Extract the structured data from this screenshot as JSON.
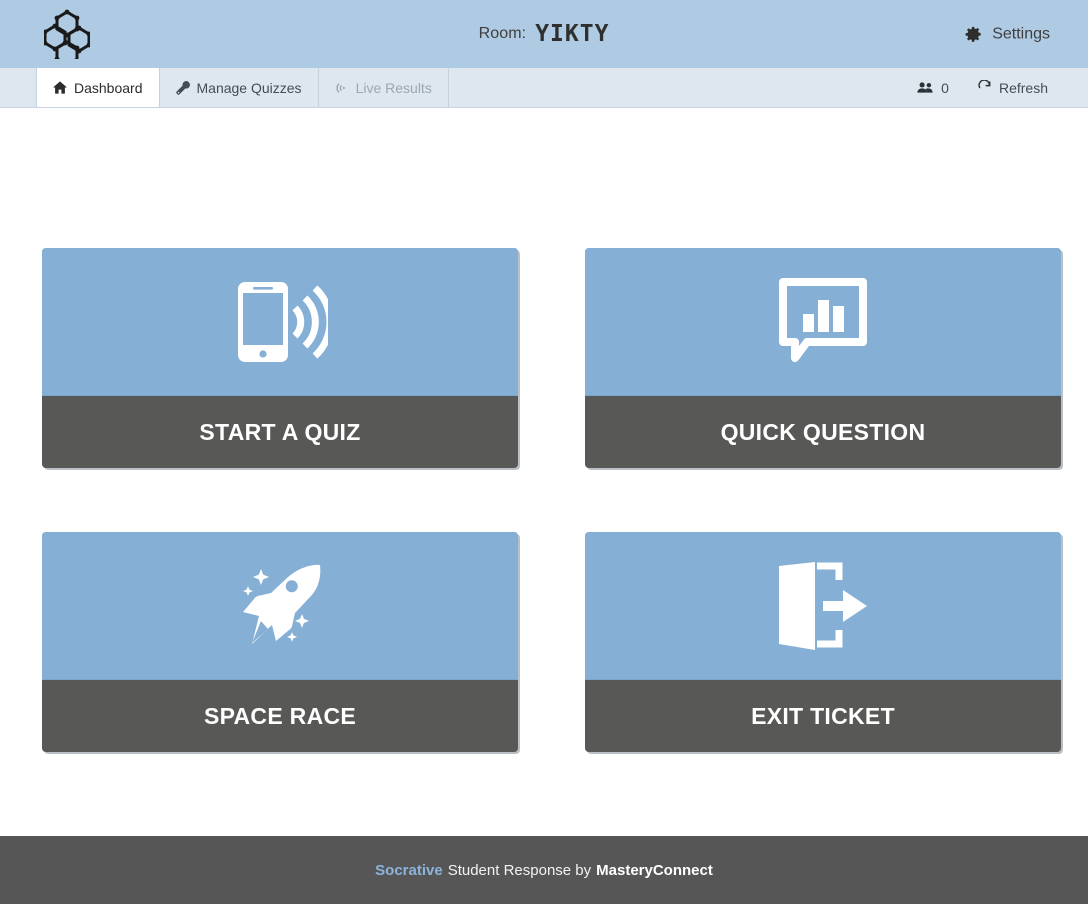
{
  "header": {
    "logo_icon": "socrative-hexagon-logo",
    "room_label": "Room:",
    "room_code": "YIKTY",
    "settings_label": "Settings",
    "settings_icon": "gear-icon",
    "background_color": "#afcbe3"
  },
  "tabbar": {
    "tabs": [
      {
        "label": "Dashboard",
        "icon": "home-icon",
        "state": "active"
      },
      {
        "label": "Manage Quizzes",
        "icon": "wrench-icon",
        "state": "default"
      },
      {
        "label": "Live Results",
        "icon": "signal-icon",
        "state": "disabled"
      }
    ],
    "student_count": "0",
    "student_count_icon": "users-icon",
    "refresh_label": "Refresh",
    "refresh_icon": "refresh-icon",
    "background_color": "#dee7ef"
  },
  "main": {
    "cards": [
      {
        "label": "START A QUIZ",
        "icon": "mobile-signal-icon"
      },
      {
        "label": "QUICK QUESTION",
        "icon": "chat-bar-chart-icon"
      },
      {
        "label": "SPACE RACE",
        "icon": "rocket-icon"
      },
      {
        "label": "EXIT TICKET",
        "icon": "exit-door-icon"
      }
    ],
    "card_tile_color": "#85afd5",
    "card_label_color": "#585857"
  },
  "footer": {
    "brand": "Socrative",
    "text": "Student Response by",
    "partner": "MasteryConnect",
    "brand_color": "#8cb4dc",
    "background_color": "#565656"
  }
}
